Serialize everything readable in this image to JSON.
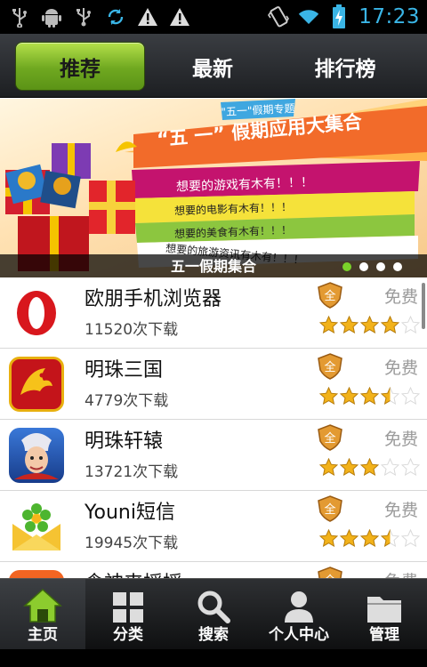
{
  "status_bar": {
    "time": "17:23"
  },
  "tabs": [
    {
      "label": "推荐",
      "active": true
    },
    {
      "label": "最新",
      "active": false
    },
    {
      "label": "排行榜",
      "active": false
    }
  ],
  "banner": {
    "tag": "\"五一\"假期专题",
    "headline": "“五 一” 假期应用大集合",
    "lines": [
      "想要的游戏有木有！！！",
      "想要的电影有木有！！！",
      "想要的美食有木有！！！",
      "想要的旅游资讯有木有！！！"
    ],
    "caption": "五一假期集合",
    "slide_count": 4,
    "active_slide": 1
  },
  "apps": [
    {
      "name": "欧朋手机浏览器",
      "downloads": "11520次下载",
      "price": "免费",
      "rating": 4,
      "icon": "opera-icon"
    },
    {
      "name": "明珠三国",
      "downloads": "4779次下载",
      "price": "免费",
      "rating": 3.5,
      "icon": "dragon-icon"
    },
    {
      "name": "明珠轩辕",
      "downloads": "13721次下载",
      "price": "免费",
      "rating": 3,
      "icon": "warrior-icon"
    },
    {
      "name": "Youni短信",
      "downloads": "19945次下载",
      "price": "免费",
      "rating": 3.5,
      "icon": "flower-envelope-icon"
    },
    {
      "name": "食神来摇摇",
      "downloads": "",
      "price": "免费",
      "rating": 0,
      "icon": "food-icon"
    }
  ],
  "bottom_nav": [
    {
      "label": "主页",
      "icon": "home-icon",
      "active": true
    },
    {
      "label": "分类",
      "icon": "grid-icon",
      "active": false
    },
    {
      "label": "搜索",
      "icon": "search-icon",
      "active": false
    },
    {
      "label": "个人中心",
      "icon": "person-icon",
      "active": false
    },
    {
      "label": "管理",
      "icon": "folder-icon",
      "active": false
    }
  ],
  "colors": {
    "accent_green": "#6fa820",
    "clock_blue": "#3ab5e6",
    "star_gold": "#f2b21a"
  }
}
